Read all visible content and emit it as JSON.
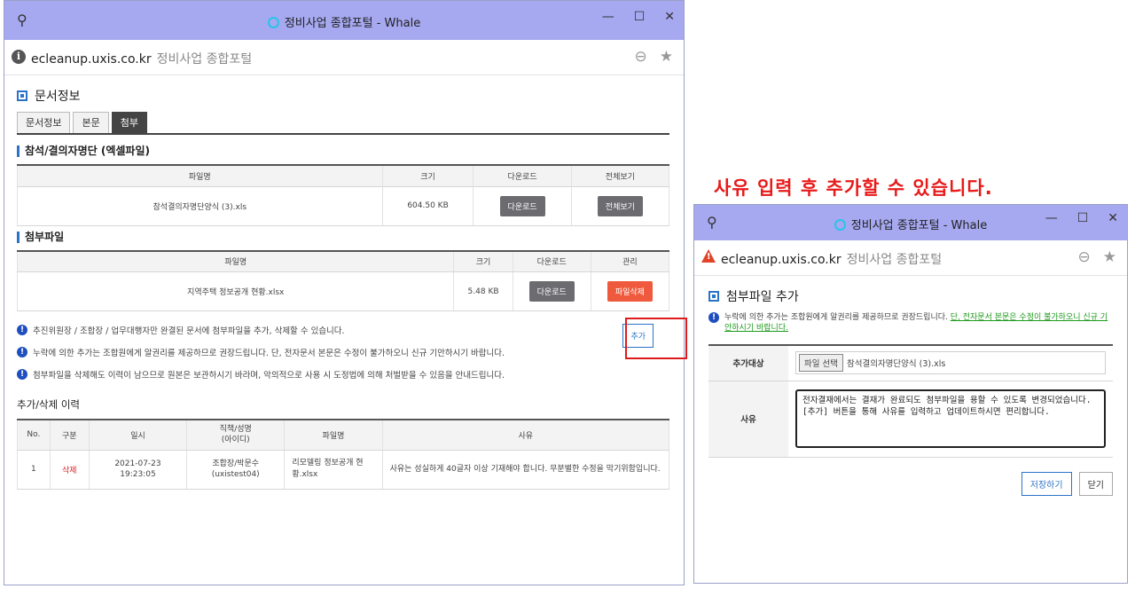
{
  "headline": "사유 입력 후 추가할 수 있습니다.",
  "main_window": {
    "title": "정비사업 종합포털 - Whale",
    "url": "ecleanup.uxis.co.kr",
    "site_name": "정비사업 종합포털",
    "section_title": "문서정보",
    "tabs": [
      "문서정보",
      "본문",
      "첨부"
    ],
    "attendance": {
      "title": "참석/결의자명단 (엑셀파일)",
      "headers": [
        "파일명",
        "크기",
        "다운로드",
        "전체보기"
      ],
      "row": {
        "file": "참석결의자명단양식 (3).xls",
        "size": "604.50 KB",
        "download": "다운로드",
        "view": "전체보기"
      }
    },
    "attachments": {
      "title": "첨부파일",
      "headers": [
        "파일명",
        "크기",
        "다운로드",
        "관리"
      ],
      "row": {
        "file": "지역주택 정보공개 현황.xlsx",
        "size": "5.48 KB",
        "download": "다운로드",
        "delete": "파일삭제"
      }
    },
    "add_button": "추가",
    "notes": [
      "추진위원장 / 조합장 / 업무대행자만 완결된 문서에 첨부파일을 추가, 삭제할 수 있습니다.",
      "누락에 의한 추가는 조합원에게 알권리를 제공하므로 권장드립니다. 단, 전자문서 본문은 수정이 불가하오니 신규 기안하시기 바랍니다.",
      "첨부파일을 삭제해도 이력이 남으므로 원본은 보관하시기 바라며, 악의적으로 사용 시 도정법에 의해 처벌받을 수 있음을 안내드립니다."
    ],
    "history": {
      "title": "추가/삭제 이력",
      "headers": [
        "No.",
        "구분",
        "일시",
        "직책/성명\n(아이디)",
        "파일명",
        "사유"
      ],
      "row": {
        "no": "1",
        "type": "삭제",
        "date": "2021-07-23\n19:23:05",
        "person": "조합장/박문수\n(uxistest04)",
        "file": "리모델링 정보공개 현황.xlsx",
        "reason": "사유는 성실하게 40글자 이상 기재해야 합니다. 무분별한 수정을 막기위함입니다."
      }
    }
  },
  "side_window": {
    "title": "정비사업 종합포털 - Whale",
    "url": "ecleanup.uxis.co.kr",
    "site_name": "정비사업 종합포털",
    "section_title": "첨부파일 추가",
    "note_plain": "누락에 의한 추가는 조합원에게 알권리를 제공하므로 권장드립니다. ",
    "note_green": "단, 전자문서 본문은 수정이 불가하오니 신규 기안하시기 바랍니다.",
    "target_label": "추가대상",
    "file_button": "파일 선택",
    "file_name": "참석결의자명단양식 (3).xls",
    "reason_label": "사유",
    "reason_text": "전자결재에서는 결재가 완료되도 첨부파일을 용할 수 있도록 변경되었습니다. [추가] 버튼을 통해 사유를 입력하고 업데이트하시면 편리합니다.",
    "save_button": "저장하기",
    "close_button": "닫기"
  }
}
